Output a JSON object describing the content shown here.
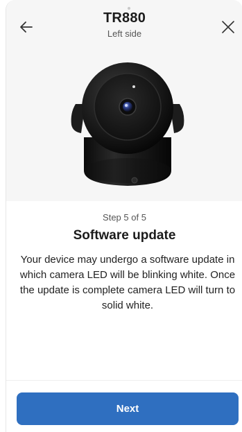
{
  "header": {
    "title": "TR880",
    "subtitle": "Left side",
    "back_icon": "arrow-left-icon",
    "close_icon": "close-icon"
  },
  "hero": {
    "image": "security-camera-illustration"
  },
  "content": {
    "step_label": "Step 5 of 5",
    "heading": "Software update",
    "description": "Your device may undergo a software update in which camera LED will be blinking white. Once the update is complete camera LED will turn to solid white."
  },
  "footer": {
    "next_label": "Next"
  },
  "colors": {
    "accent": "#2f6fc0",
    "hero_background": "#f6f6f6",
    "text_primary": "#1b1b1b",
    "text_secondary": "#555555"
  }
}
